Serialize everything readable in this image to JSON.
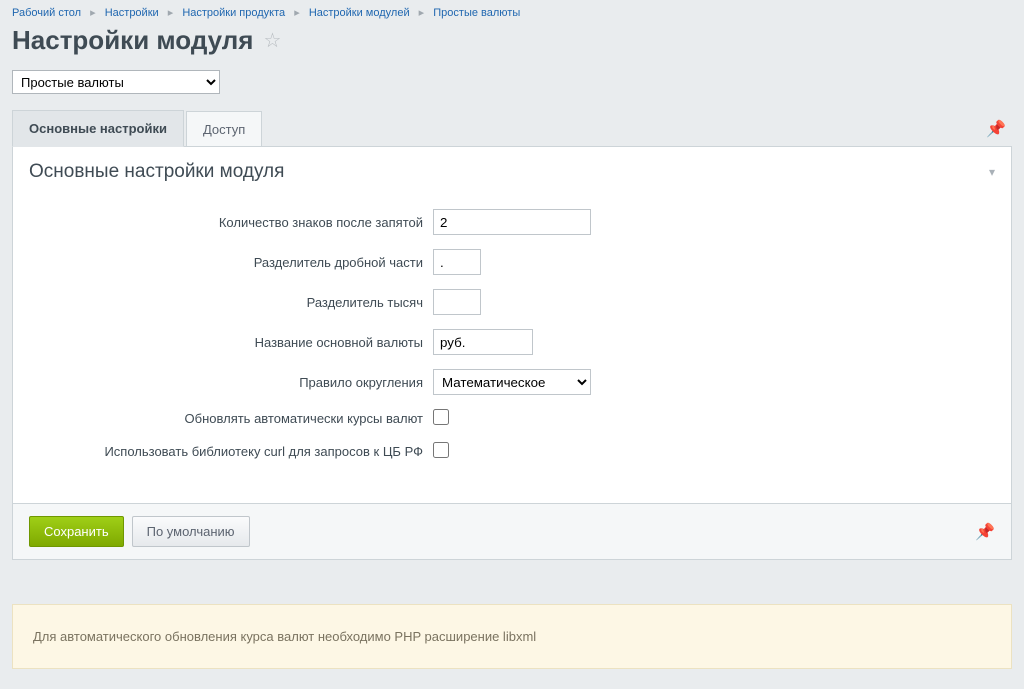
{
  "breadcrumbs": [
    "Рабочий стол",
    "Настройки",
    "Настройки продукта",
    "Настройки модулей",
    "Простые валюты"
  ],
  "page_title": "Настройки модуля",
  "module_select_value": "Простые валюты",
  "tabs": {
    "main": "Основные настройки",
    "access": "Доступ"
  },
  "panel_title": "Основные настройки модуля",
  "fields": {
    "decimals": {
      "label": "Количество знаков после запятой",
      "value": "2"
    },
    "decimal_sep": {
      "label": "Разделитель дробной части",
      "value": "."
    },
    "thousand_sep": {
      "label": "Разделитель тысяч",
      "value": ""
    },
    "base_currency": {
      "label": "Название основной валюты",
      "value": "руб."
    },
    "rounding": {
      "label": "Правило округления",
      "value": "Математическое"
    },
    "auto_update": {
      "label": "Обновлять автоматически курсы валют"
    },
    "use_curl": {
      "label": "Использовать библиотеку curl для запросов к ЦБ РФ"
    }
  },
  "buttons": {
    "save": "Сохранить",
    "default": "По умолчанию"
  },
  "notice_text": "Для автоматического обновления курса валют необходимо PHP расширение libxml"
}
